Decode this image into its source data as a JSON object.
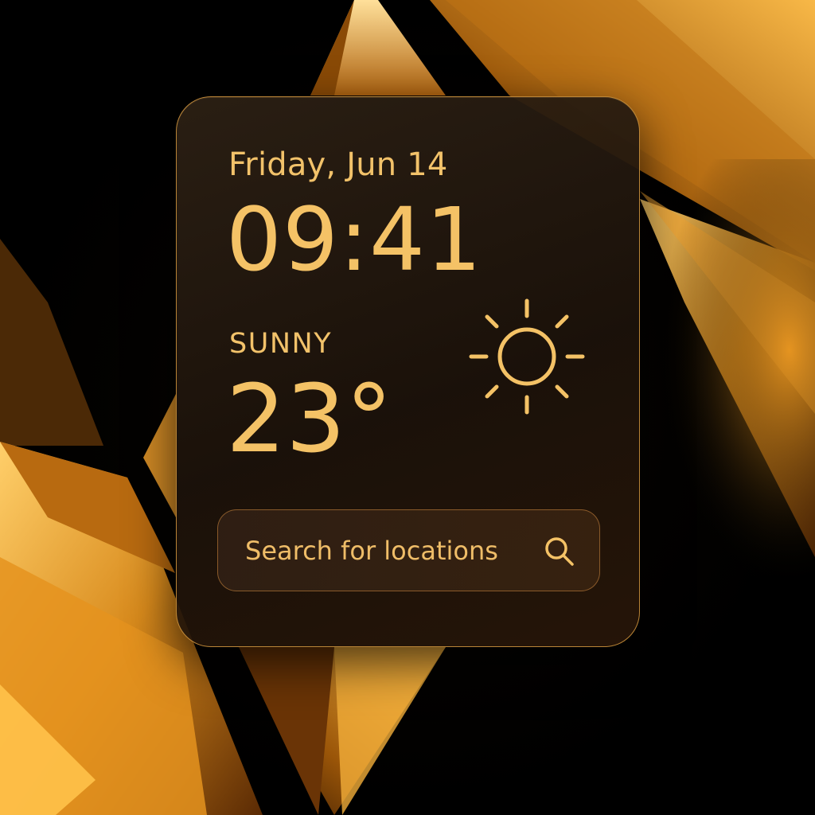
{
  "widget": {
    "date": "Friday, Jun 14",
    "time": "09:41",
    "condition": "SUNNY",
    "temperature": "23°",
    "weather_icon": "sun-icon"
  },
  "search": {
    "placeholder": "Search for locations",
    "icon": "search-icon"
  },
  "colors": {
    "accent": "#f4c266",
    "background": "#000000",
    "gold": "#e8a335"
  }
}
